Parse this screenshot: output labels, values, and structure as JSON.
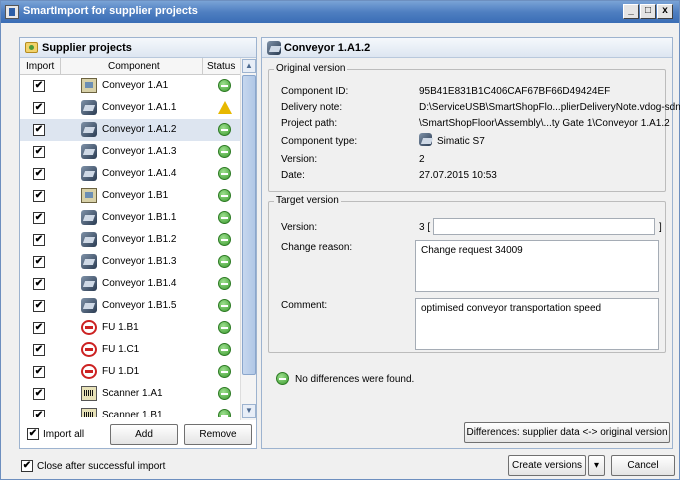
{
  "window": {
    "title": "SmartImport for supplier projects",
    "buttons": [
      "_",
      "□",
      "x"
    ]
  },
  "left_panel": {
    "title": "Supplier projects",
    "columns": {
      "import": "Import",
      "component": "Component",
      "status": "Status"
    },
    "rows": [
      {
        "checked": true,
        "icon": "panel-icon",
        "label": "Conveyor 1.A1",
        "status": "ok"
      },
      {
        "checked": true,
        "icon": "plc-icon",
        "label": "Conveyor 1.A1.1",
        "status": "warning"
      },
      {
        "checked": true,
        "icon": "plc-icon",
        "label": "Conveyor 1.A1.2",
        "status": "ok",
        "selected": true
      },
      {
        "checked": true,
        "icon": "plc-icon",
        "label": "Conveyor 1.A1.3",
        "status": "ok"
      },
      {
        "checked": true,
        "icon": "plc-icon",
        "label": "Conveyor 1.A1.4",
        "status": "ok"
      },
      {
        "checked": true,
        "icon": "panel-icon",
        "label": "Conveyor 1.B1",
        "status": "ok"
      },
      {
        "checked": true,
        "icon": "plc-icon",
        "label": "Conveyor 1.B1.1",
        "status": "ok"
      },
      {
        "checked": true,
        "icon": "plc-icon",
        "label": "Conveyor 1.B1.2",
        "status": "ok"
      },
      {
        "checked": true,
        "icon": "plc-icon",
        "label": "Conveyor 1.B1.3",
        "status": "ok"
      },
      {
        "checked": true,
        "icon": "plc-icon",
        "label": "Conveyor 1.B1.4",
        "status": "ok"
      },
      {
        "checked": true,
        "icon": "plc-icon",
        "label": "Conveyor 1.B1.5",
        "status": "ok"
      },
      {
        "checked": true,
        "icon": "fu-icon",
        "label": "FU 1.B1",
        "status": "ok"
      },
      {
        "checked": true,
        "icon": "fu-icon",
        "label": "FU 1.C1",
        "status": "ok"
      },
      {
        "checked": true,
        "icon": "fu-icon",
        "label": "FU 1.D1",
        "status": "ok"
      },
      {
        "checked": true,
        "icon": "scanner-icon",
        "label": "Scanner 1.A1",
        "status": "ok"
      },
      {
        "checked": true,
        "icon": "scanner-icon",
        "label": "Scanner 1.B1",
        "status": "ok"
      }
    ],
    "import_all": {
      "checked": true,
      "label": "Import all"
    },
    "add_label": "Add",
    "remove_label": "Remove"
  },
  "right_panel": {
    "title": "Conveyor 1.A1.2",
    "original": {
      "legend": "Original version",
      "component_id_label": "Component ID:",
      "component_id": "95B41E831B1C406CAF67BF66D49424EF",
      "delivery_note_label": "Delivery note:",
      "delivery_note": "D:\\ServiceUSB\\SmartShopFlo...plierDeliveryNote.vdog-sdn",
      "project_path_label": "Project path:",
      "project_path": "\\SmartShopFloor\\Assembly\\...ty Gate 1\\Conveyor 1.A1.2",
      "component_type_label": "Component type:",
      "component_type": "Simatic S7",
      "version_label": "Version:",
      "version": "2",
      "date_label": "Date:",
      "date": "27.07.2015 10:53"
    },
    "target": {
      "legend": "Target version",
      "version_label": "Version:",
      "version_prefix": "3 [",
      "version_suffix": "]",
      "version_input": "",
      "change_reason_label": "Change reason:",
      "change_reason": "Change request 34009",
      "comment_label": "Comment:",
      "comment": "optimised conveyor transportation speed"
    },
    "diff_message": "No differences were found.",
    "differences_button": "Differences: supplier data <-> original version"
  },
  "bottom": {
    "close_after_import": {
      "checked": true,
      "label": "Close after successful import"
    },
    "create_versions_label": "Create versions",
    "dropdown_arrow": "▾",
    "cancel_label": "Cancel"
  }
}
